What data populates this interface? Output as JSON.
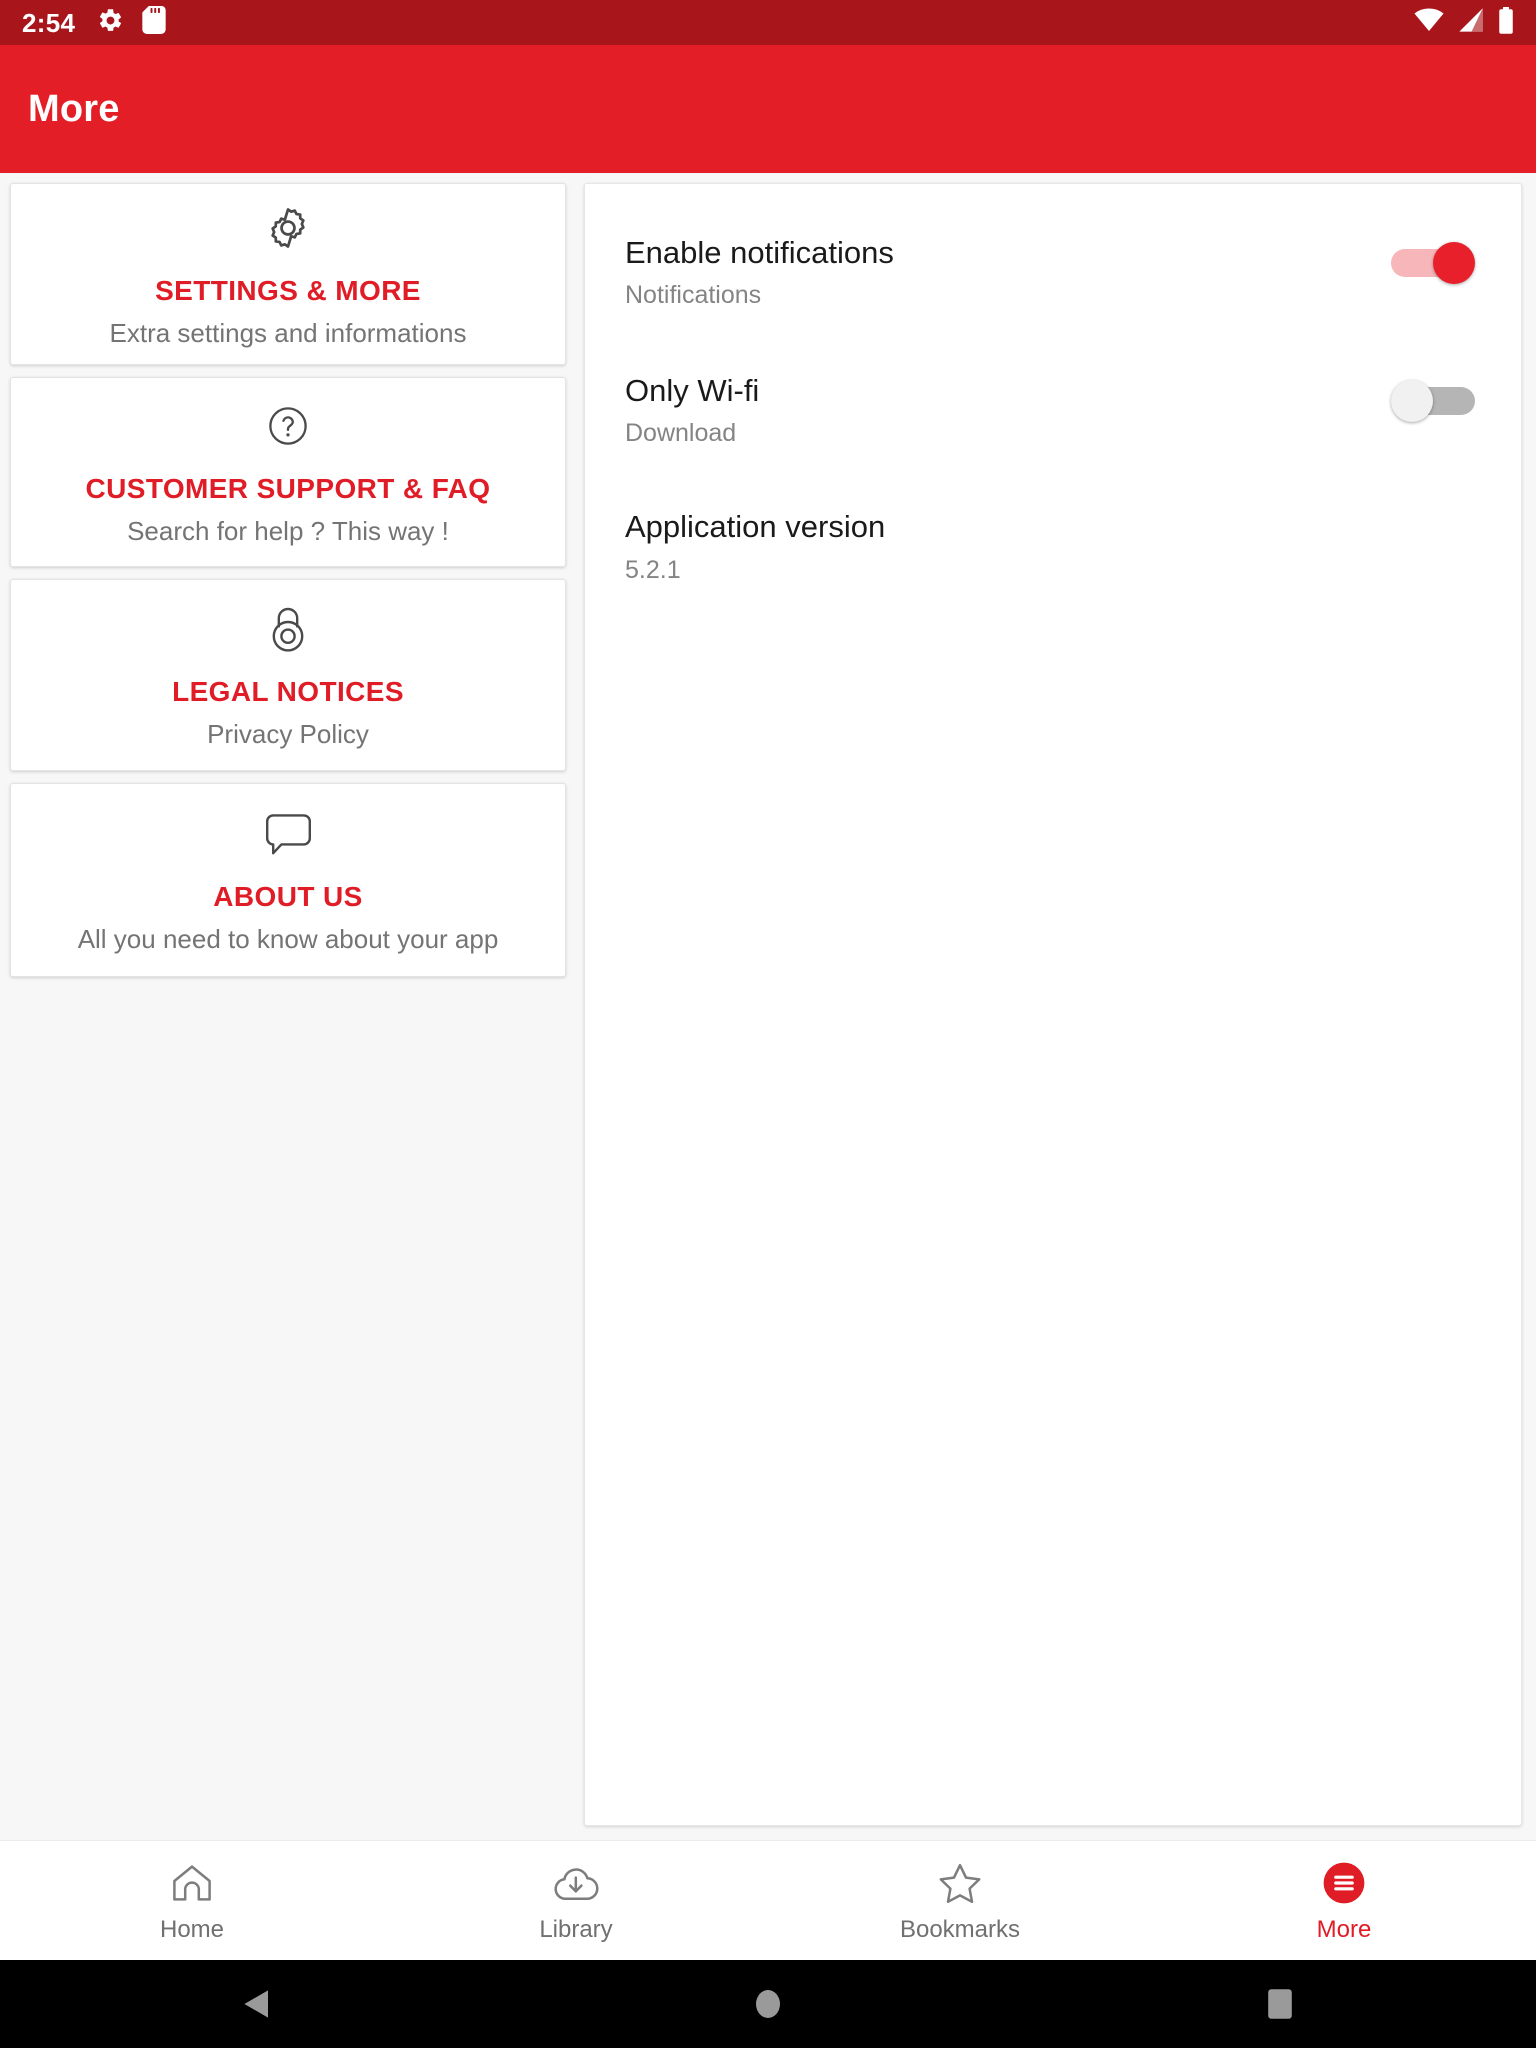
{
  "status_bar": {
    "time": "2:54",
    "left_icons": [
      "gear-icon",
      "sd-card-icon"
    ],
    "right_icons": [
      "wifi-icon",
      "signal-icon",
      "battery-icon"
    ],
    "background": "#a8161c"
  },
  "app_bar": {
    "title": "More",
    "background": "#e41e26",
    "text_color": "#ffffff"
  },
  "theme": {
    "accent": "#e01d26",
    "toggle_on_thumb": "#e8202b",
    "toggle_on_track": "#f7b6ba",
    "toggle_off_thumb": "#f1f1f1",
    "toggle_off_track": "#b5b5b5",
    "page_background": "#f7f7f7"
  },
  "menu_cards": [
    {
      "icon": "gear-icon",
      "title": "SETTINGS & MORE",
      "subtitle": "Extra settings and informations"
    },
    {
      "icon": "question-circle-icon",
      "title": "CUSTOMER SUPPORT & FAQ",
      "subtitle": "Search for help ? This way !"
    },
    {
      "icon": "padlock-icon",
      "title": "LEGAL NOTICES",
      "subtitle": "Privacy Policy"
    },
    {
      "icon": "chat-bubble-icon",
      "title": "ABOUT US",
      "subtitle": "All you need to know about your app"
    }
  ],
  "settings_panel": {
    "rows": [
      {
        "title": "Enable notifications",
        "subtitle": "Notifications",
        "control": "switch",
        "state": "on"
      },
      {
        "title": "Only Wi-fi",
        "subtitle": "Download",
        "control": "switch",
        "state": "off"
      },
      {
        "title": "Application version",
        "subtitle": "5.2.1",
        "control": "none",
        "state": ""
      }
    ]
  },
  "bottom_nav": {
    "items": [
      {
        "label": "Home",
        "icon": "home-icon",
        "active": false
      },
      {
        "label": "Library",
        "icon": "cloud-download-icon",
        "active": false
      },
      {
        "label": "Bookmarks",
        "icon": "star-icon",
        "active": false
      },
      {
        "label": "More",
        "icon": "hamburger-circle-icon",
        "active": true
      }
    ]
  },
  "system_nav": {
    "buttons": [
      "back-triangle-icon",
      "home-circle-icon",
      "recents-square-icon"
    ]
  }
}
